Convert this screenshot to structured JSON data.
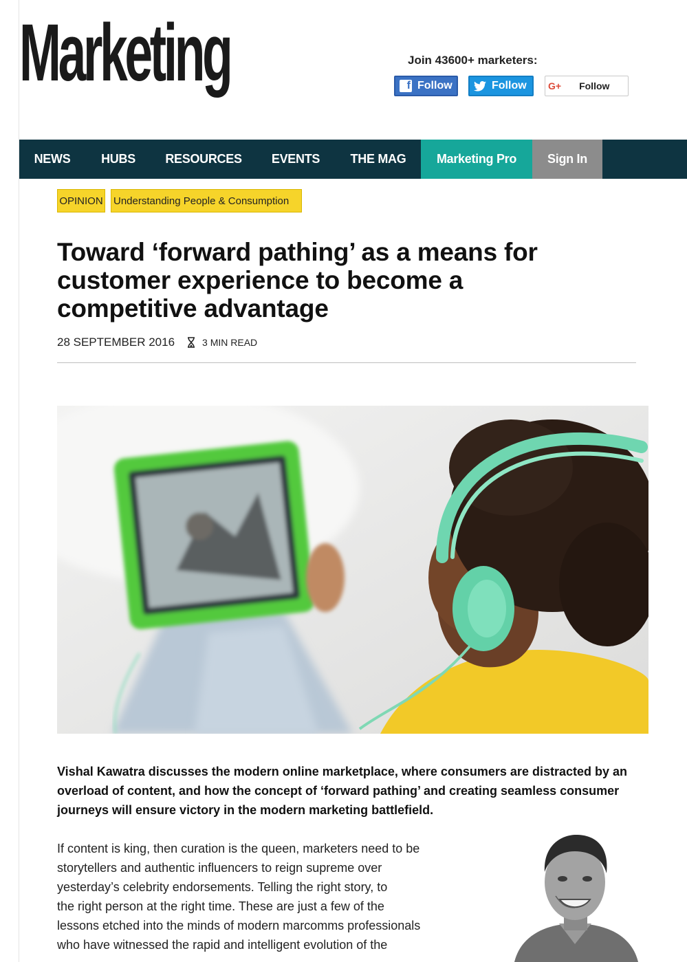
{
  "header": {
    "logo": "Marketing",
    "join_text": "Join 43600+ marketers:",
    "facebook_label": "Follow",
    "twitter_label": "Follow",
    "google_label": "Follow",
    "google_icon": "G+"
  },
  "nav": {
    "items": [
      {
        "label": "NEWS"
      },
      {
        "label": "HUBS"
      },
      {
        "label": "RESOURCES"
      },
      {
        "label": "EVENTS"
      },
      {
        "label": "THE MAG"
      },
      {
        "label": "Marketing Pro"
      },
      {
        "label": "Sign In"
      }
    ],
    "bg_color": "#0e3441",
    "pro_color": "#16a79a",
    "signin_color": "#8c8c8c"
  },
  "article": {
    "tags": [
      "OPINION",
      "Understanding People & Consumption"
    ],
    "tag_color": "#f6d42a",
    "title": "Toward ‘forward pathing’ as a means for customer experience to become a competitive advantage",
    "date": "28 SEPTEMBER 2016",
    "read_time": "3 MIN READ",
    "standfirst": "Vishal Kawatra discusses the modern online marketplace, where consumers are distracted by an overload of content, and how the concept of ‘forward pathing’ and creating seamless consumer journeys will ensure victory in the modern marketing battlefield.",
    "body_lines": [
      "If content is king, then curation is the queen, marketers need to be",
      "storytellers and authentic influencers to reign supreme over",
      "yesterday’s celebrity endorsements. Telling the right story, to",
      "the right person at the right time. These are just a few of the",
      "lessons etched into the minds of modern marcomms professionals",
      "who have witnessed the rapid and intelligent evolution of the"
    ]
  }
}
